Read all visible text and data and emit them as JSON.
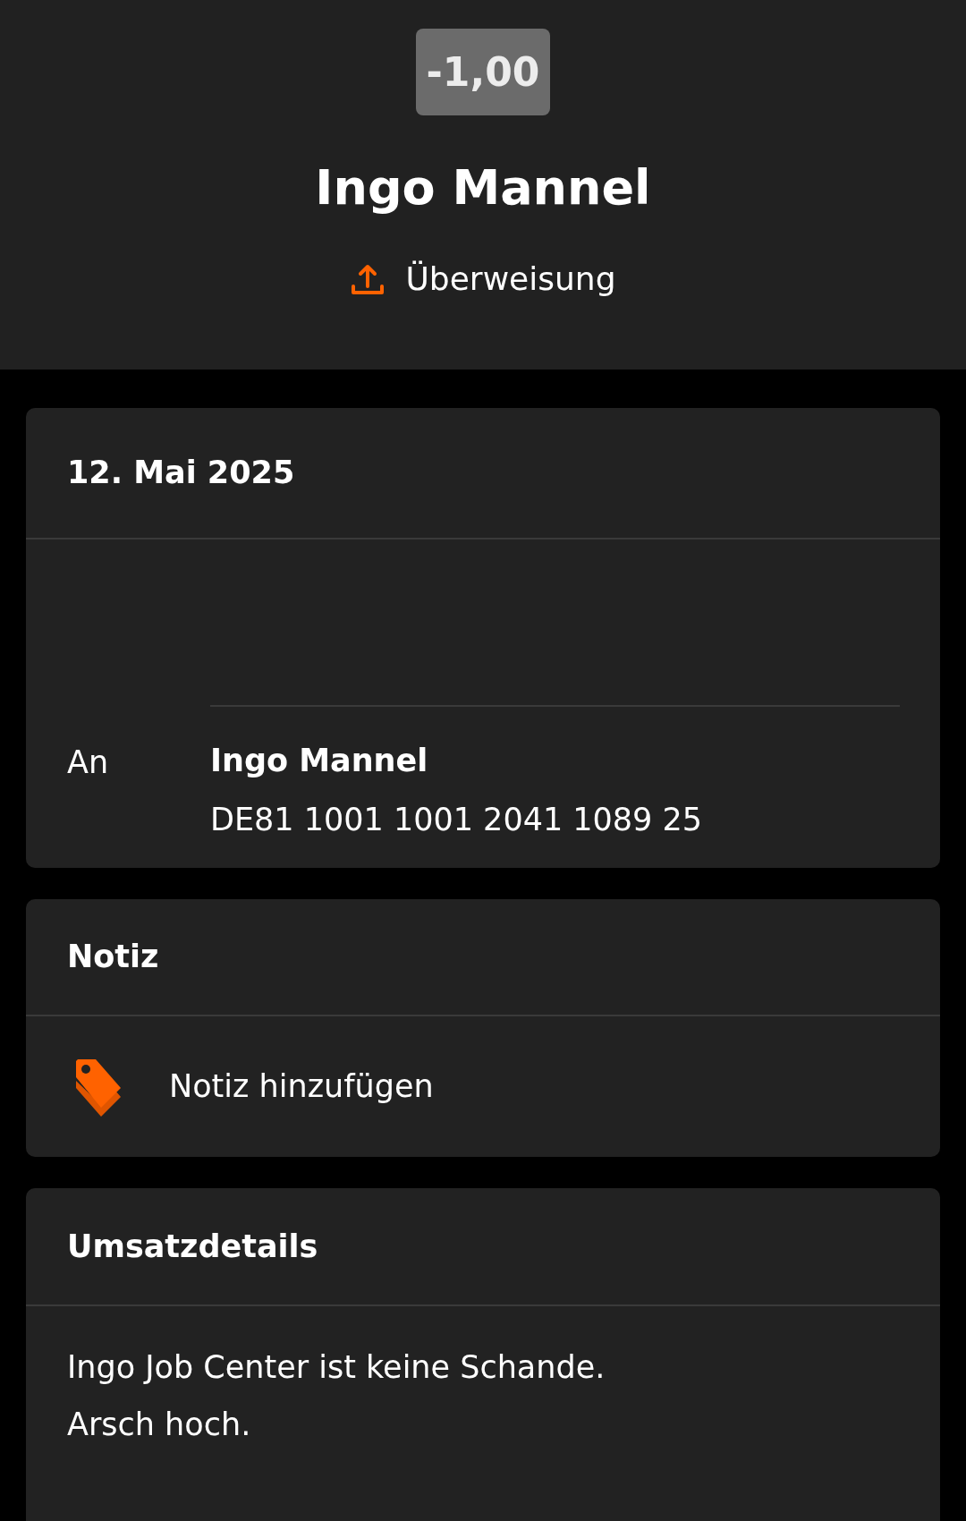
{
  "header": {
    "amount": "-1,00",
    "name": "Ingo Mannel",
    "type": "Überweisung"
  },
  "date_card": {
    "title": "12. Mai 2025",
    "recipient_label": "An",
    "recipient_name": "Ingo Mannel",
    "iban": "DE81 1001 1001 2041 1089 25"
  },
  "note_card": {
    "title": "Notiz",
    "action": "Notiz hinzufügen"
  },
  "details_card": {
    "title": "Umsatzdetails",
    "lines": [
      "Ingo Job Center ist keine Schande.",
      "Arsch hoch."
    ]
  }
}
